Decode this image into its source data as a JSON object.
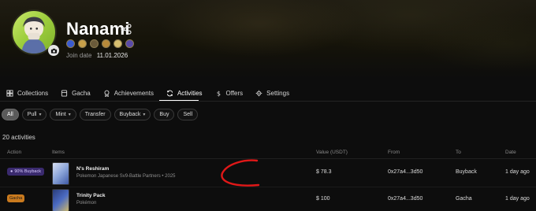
{
  "profile": {
    "username": "Nanami",
    "join_label": "Join date",
    "join_date": "11.01.2026",
    "badge_colors": [
      "#3a5bd1",
      "#c8a04a",
      "#6a5a3a",
      "#b88a3a",
      "#d8c070",
      "#5a4aa8"
    ]
  },
  "tabs": [
    {
      "label": "Collections",
      "icon": "collections-icon"
    },
    {
      "label": "Gacha",
      "icon": "gacha-icon"
    },
    {
      "label": "Achievements",
      "icon": "achievements-icon"
    },
    {
      "label": "Activities",
      "icon": "activities-icon",
      "active": true
    },
    {
      "label": "Offers",
      "icon": "dollar-icon"
    },
    {
      "label": "Settings",
      "icon": "gear-icon"
    }
  ],
  "filters": [
    {
      "label": "All",
      "active": true,
      "dropdown": false
    },
    {
      "label": "Pull",
      "dropdown": true
    },
    {
      "label": "Mint",
      "dropdown": true
    },
    {
      "label": "Transfer",
      "dropdown": false
    },
    {
      "label": "Buyback",
      "dropdown": true
    },
    {
      "label": "Buy",
      "dropdown": false
    },
    {
      "label": "Sell",
      "dropdown": false
    }
  ],
  "activities_count": "20 activities",
  "table": {
    "headers": {
      "action": "Action",
      "items": "Items",
      "value": "Value (USDT)",
      "from": "From",
      "to": "To",
      "date": "Date"
    },
    "rows": [
      {
        "action": "90% Buyback",
        "action_type": "buyback",
        "item_name": "N's Reshiram",
        "item_sub": "Pokemon Japanese Sv9-Battle Partners • 2025",
        "value": "$ 78.3",
        "from": "0x27a4...3d50",
        "to": "Buyback",
        "date": "1 day ago"
      },
      {
        "action": "Gacha",
        "action_type": "gacha",
        "item_name": "Trinity Pack",
        "item_sub": "Pokémon",
        "value": "$ 100",
        "from": "0x27a4...3d50",
        "to": "Gacha",
        "date": "1 day ago"
      }
    ]
  },
  "colors": {
    "background": "#0d0d0d",
    "annotation": "#e01818",
    "buyback_badge": "#3a2a6e",
    "gacha_badge": "#c97a1e"
  }
}
